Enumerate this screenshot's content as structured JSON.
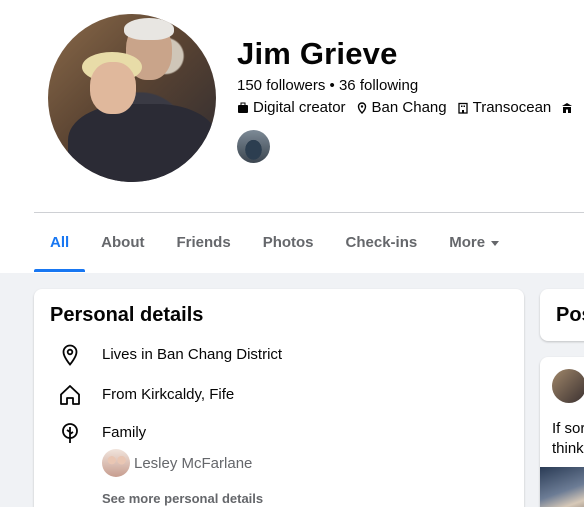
{
  "profile": {
    "name": "Jim Grieve",
    "followers_line": "150 followers • 36 following",
    "meta": [
      {
        "icon": "briefcase-icon",
        "text": "Digital creator"
      },
      {
        "icon": "location-pin-icon",
        "text": "Ban Chang"
      },
      {
        "icon": "building-icon",
        "text": "Transocean"
      },
      {
        "icon": "school-icon",
        "text": ""
      }
    ]
  },
  "tabs": [
    {
      "label": "All",
      "active": true
    },
    {
      "label": "About"
    },
    {
      "label": "Friends"
    },
    {
      "label": "Photos"
    },
    {
      "label": "Check-ins"
    },
    {
      "label": "More"
    }
  ],
  "personal_details": {
    "title": "Personal details",
    "lives_in": "Lives in Ban Chang District",
    "from": "From Kirkcaldy, Fife",
    "family_label": "Family",
    "family_member": "Lesley McFarlane",
    "see_more": "See more personal details"
  },
  "posts": {
    "title": "Pos",
    "text_line1": "If sor",
    "text_line2": "think"
  },
  "colors": {
    "accent": "#1877f2",
    "muted": "#65676b",
    "background": "#f0f2f5"
  }
}
